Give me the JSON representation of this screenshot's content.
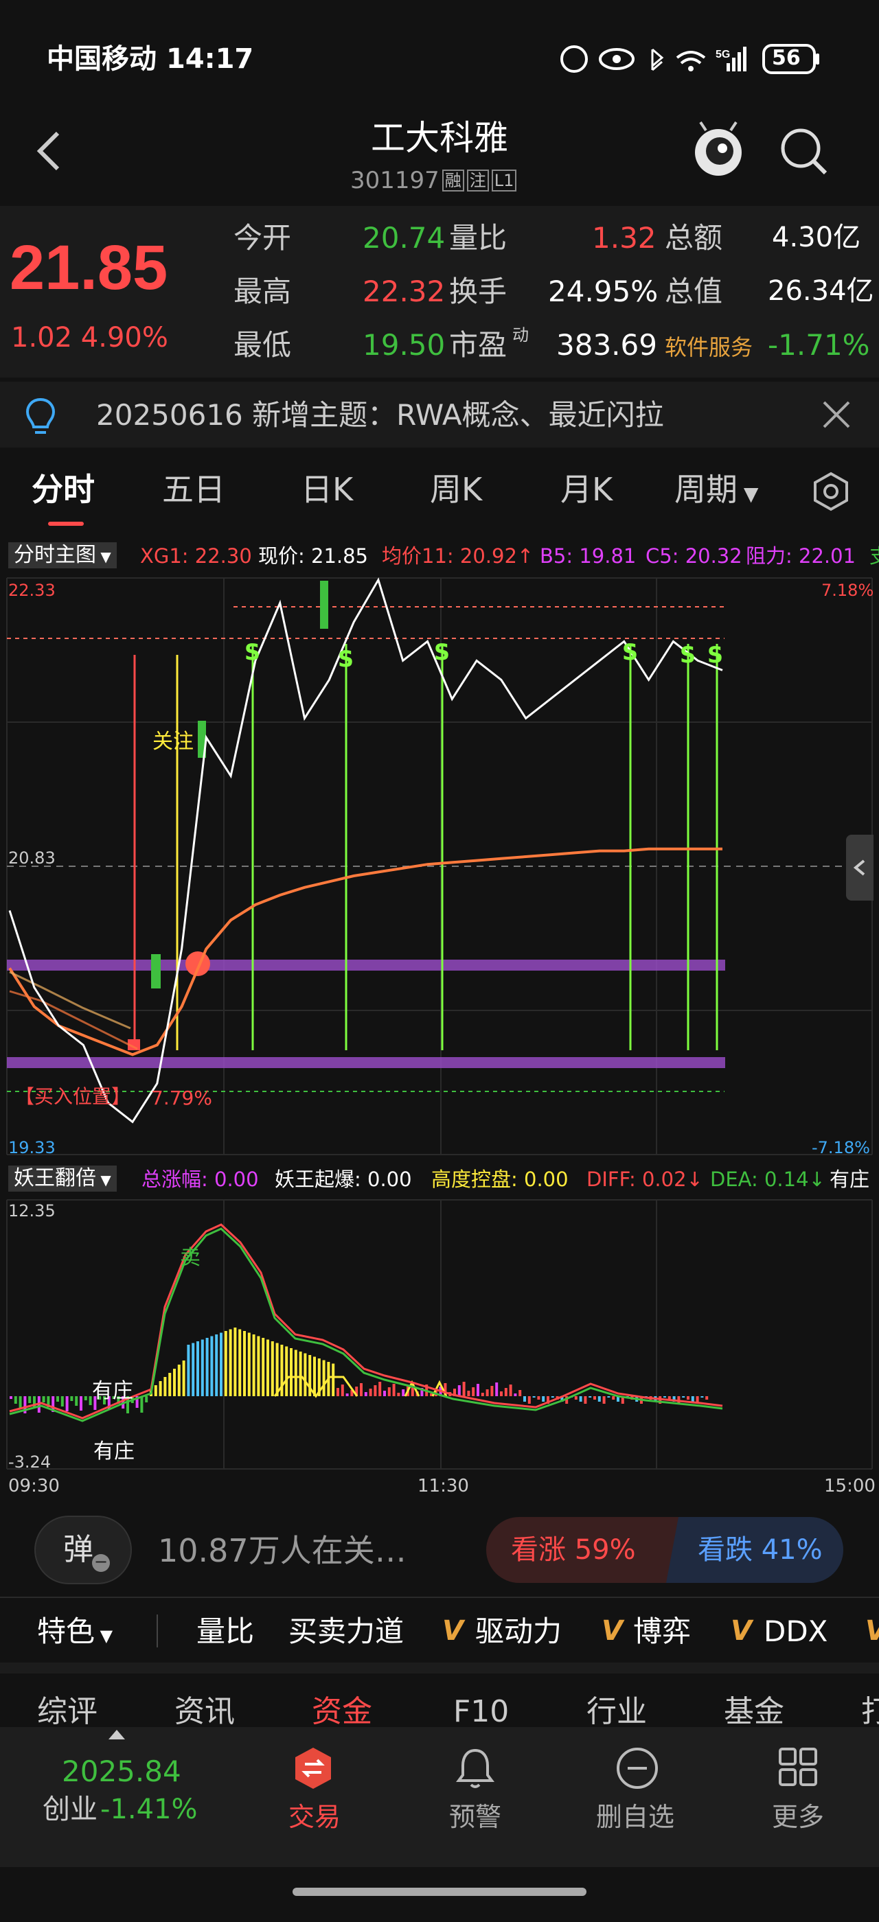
{
  "status_bar": {
    "carrier": "中国移动",
    "time": "14:17",
    "battery": "56",
    "network": "5G"
  },
  "header": {
    "title": "工大科雅",
    "code": "301197",
    "badges": [
      "融",
      "注",
      "L1"
    ]
  },
  "quote": {
    "price": "21.85",
    "change": "1.02",
    "change_pct": "4.90%",
    "stats": [
      [
        {
          "k": "今开",
          "v": "20.74",
          "c": "#3fbf3f"
        },
        {
          "k": "量比",
          "v": "1.32",
          "c": "#ff4a4a"
        },
        {
          "k": "总额",
          "v": "4.30亿",
          "c": "#ffffff"
        }
      ],
      [
        {
          "k": "最高",
          "v": "22.32",
          "c": "#ff4a4a"
        },
        {
          "k": "换手",
          "v": "24.95%",
          "c": "#ffffff"
        },
        {
          "k": "总值",
          "v": "26.34亿",
          "c": "#ffffff"
        }
      ],
      [
        {
          "k": "最低",
          "v": "19.50",
          "c": "#3fbf3f"
        },
        {
          "k": "市盈",
          "sup": "动",
          "v": "383.69",
          "c": "#ffffff"
        },
        {
          "k": "软件服务",
          "v": "-1.71%",
          "c": "#3fbf3f"
        }
      ]
    ]
  },
  "notice": {
    "text": "20250616 新增主题：RWA概念、最近闪拉"
  },
  "tabs": {
    "items": [
      "分时",
      "五日",
      "日K",
      "周K",
      "月K",
      "周期"
    ],
    "active": 0
  },
  "main_chart": {
    "selector": "分时主图",
    "indicators": [
      {
        "label": "XG1: 22.30",
        "color": "#ff4a4a"
      },
      {
        "label": "现价: 21.85",
        "color": "#ffffff"
      },
      {
        "label": "均价11: 20.92↑",
        "color": "#ff4a4a"
      },
      {
        "label": "B5: 19.81",
        "color": "#e040fb"
      },
      {
        "label": "C5: 20.32",
        "color": "#e040fb"
      },
      {
        "label": "阻力: 22.01",
        "color": "#e040fb"
      },
      {
        "label": "支",
        "color": "#3fbf3f"
      }
    ],
    "y_high": "22.33",
    "y_mid": "20.83",
    "y_low": "19.33",
    "pct_high": "7.18%",
    "pct_low": "-7.18%",
    "buy_label": "【买入位置】",
    "buy_pct": "7.79%",
    "watch_label": "关注",
    "sell_marks": [
      "S",
      "S",
      "S",
      "S",
      "S",
      "S"
    ]
  },
  "chart_data": {
    "type": "line",
    "x_range": [
      "09:30",
      "15:00"
    ],
    "ylim": [
      19.33,
      22.33
    ],
    "pre_close": 20.83,
    "series": [
      {
        "name": "现价",
        "color": "#ffffff",
        "values": [
          20.6,
          20.2,
          20.0,
          19.9,
          19.6,
          19.5,
          19.7,
          20.4,
          21.5,
          21.3,
          21.9,
          22.2,
          21.6,
          21.8,
          22.1,
          22.32,
          21.9,
          22.0,
          21.7,
          21.9,
          21.8,
          21.6,
          21.7,
          21.8,
          21.9,
          22.0,
          21.8,
          22.0,
          21.9,
          21.85
        ]
      },
      {
        "name": "均价11",
        "color": "#ff7a3d",
        "values": [
          20.3,
          20.1,
          20.0,
          19.95,
          19.9,
          19.85,
          19.9,
          20.1,
          20.4,
          20.55,
          20.63,
          20.68,
          20.72,
          20.75,
          20.78,
          20.8,
          20.82,
          20.84,
          20.85,
          20.86,
          20.87,
          20.88,
          20.89,
          20.9,
          20.91,
          20.91,
          20.92,
          20.92,
          20.92,
          20.92
        ]
      }
    ]
  },
  "sub_chart": {
    "selector": "妖王翻倍",
    "indicators": [
      {
        "label": "总涨幅: 0.00",
        "color": "#e040fb"
      },
      {
        "label": "妖王起爆: 0.00",
        "color": "#ffffff"
      },
      {
        "label": "高度控盘: 0.00",
        "color": "#ffeb3b"
      },
      {
        "label": "DIFF: 0.02↓",
        "color": "#ff4a4a"
      },
      {
        "label": "DEA: 0.14↓",
        "color": "#3fbf3f"
      },
      {
        "label": "有庄",
        "color": "#ffffff"
      }
    ],
    "y_high": "12.35",
    "y_low": "-3.24",
    "label_zhuang": "有庄",
    "label_sell": "卖",
    "x_ticks": [
      "09:30",
      "11:30",
      "15:00"
    ]
  },
  "sentiment": {
    "bullet_label": "弹",
    "followers": "10.87万人在关…",
    "up_label": "看涨 59%",
    "down_label": "看跌 41%"
  },
  "indicator_bar": {
    "items": [
      "特色",
      "量比",
      "买卖力道",
      "驱动力",
      "博弈",
      "DDX",
      "V"
    ]
  },
  "section_tabs": {
    "items": [
      "综评",
      "资讯",
      "资金",
      "F10",
      "行业",
      "基金",
      "打"
    ],
    "active": 2
  },
  "bottom_nav": {
    "index_value": "2025.84",
    "index_name": "创业",
    "index_change": "-1.41%",
    "items": [
      {
        "label": "交易",
        "icon": "trade-icon"
      },
      {
        "label": "预警",
        "icon": "bell-icon"
      },
      {
        "label": "删自选",
        "icon": "remove-icon"
      },
      {
        "label": "更多",
        "icon": "grid-icon"
      }
    ]
  }
}
